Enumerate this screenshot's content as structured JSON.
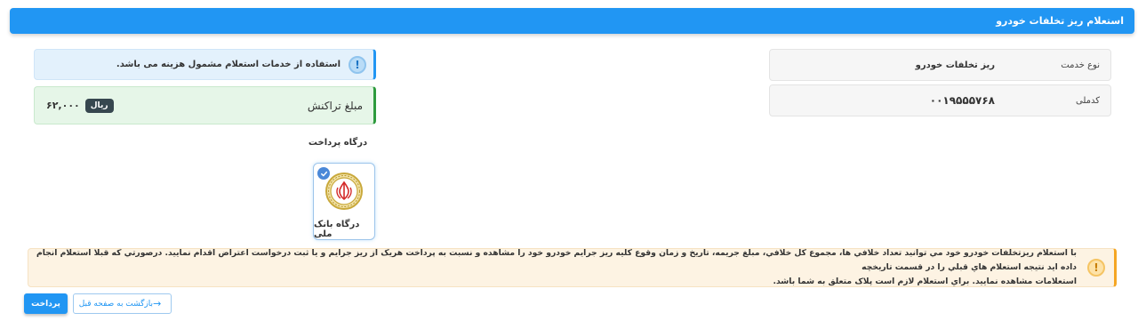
{
  "header": {
    "title": "استعلام ریز تخلفات خودرو"
  },
  "service": {
    "label": "نوع خدمت",
    "value": "ریز تخلفات خودرو"
  },
  "national_id": {
    "label": "کدملی",
    "value": "۰۰۱۹۵۵۵۷۶۸"
  },
  "notice": {
    "icon": "exclamation-icon",
    "text": "استفاده از خدمات استعلام مشمول هزینه می باشد."
  },
  "transaction": {
    "label": "مبلغ تراکنش",
    "amount": "۶۲,۰۰۰",
    "currency": "ریال"
  },
  "gateway": {
    "title": "درگاه پرداخت",
    "name": "درگاه بانک ملی",
    "selected": true
  },
  "warning": {
    "icon": "exclamation-icon",
    "line1": "با استعلام ریزتخلفات خودرو خود مي توانيد تعداد خلافي ها، مجموع کل خلافي، مبلغ جريمه، تاريخ و زمان وقوع کليه ريز جرايم خودرو خود را مشاهده و نسبت به پرداخت هريک از ريز جرايم و يا ثبت درخواست اعتراض اقدام نماييد. درصورتي که قبلا استعلام انجام داده ايد نتيجه استعلام هاي قبلي را در قسمت تاريخچه",
    "line2": "استعلامات مشاهده نماييد. براي استعلام لازم است پلاک متعلق به شما باشد."
  },
  "buttons": {
    "pay": "پرداخت",
    "back": "بازگشت به صفحه قبل"
  },
  "colors": {
    "primary": "#2196f3",
    "success": "#2e9b3e",
    "warning": "#f5a623"
  }
}
